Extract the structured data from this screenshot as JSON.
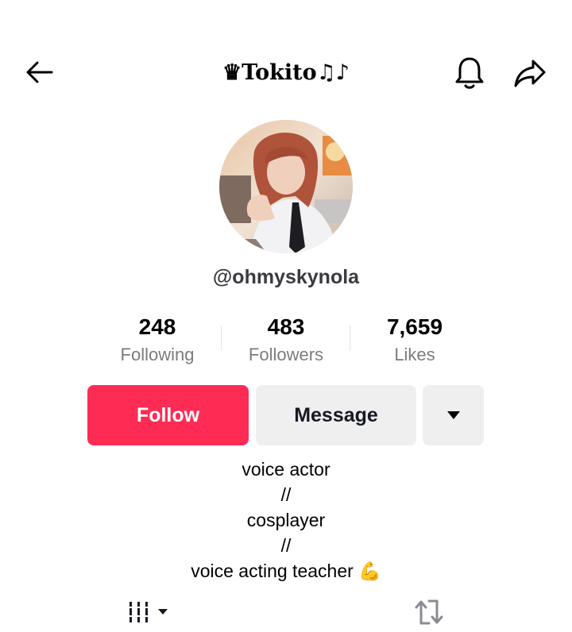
{
  "header": {
    "title": "♛Tokito♫♪",
    "back_icon": "arrow-left-icon",
    "bell_icon": "bell-icon",
    "share_icon": "share-arrow-icon"
  },
  "profile": {
    "username": "@ohmyskynola",
    "avatar_icon": "avatar-photo"
  },
  "stats": [
    {
      "value": "248",
      "label": "Following"
    },
    {
      "value": "483",
      "label": "Followers"
    },
    {
      "value": "7,659",
      "label": "Likes"
    }
  ],
  "actions": {
    "follow_label": "Follow",
    "message_label": "Message",
    "more_icon": "caret-down-icon"
  },
  "bio": {
    "lines": [
      "voice actor",
      "//",
      "cosplayer",
      "//",
      "voice acting teacher 💪"
    ]
  },
  "tabs": {
    "videos_icon": "grid-lines-icon",
    "reposts_icon": "repost-icon"
  },
  "colors": {
    "follow": "#fe2c55",
    "secondary_button": "#efeff0",
    "muted_text": "#7c7c80"
  }
}
